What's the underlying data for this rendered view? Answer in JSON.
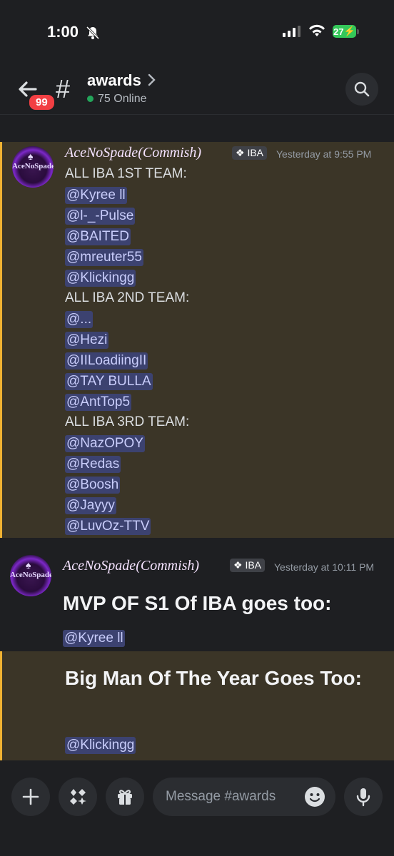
{
  "status_bar": {
    "time": "1:00",
    "battery": "27"
  },
  "header": {
    "unread_badge": "99",
    "channel_name": "awards",
    "online": "75 Online"
  },
  "messages": [
    {
      "author": "AceNoSpade(Commish)",
      "tag": "IBA",
      "timestamp": "Yesterday at 9:55 PM",
      "lines": [
        {
          "text": "ALL IBA 1ST TEAM:",
          "mention": false
        },
        {
          "text": "@Kyree ll",
          "mention": true
        },
        {
          "text": "@l-_-Pulse",
          "mention": true
        },
        {
          "text": "@BAITED",
          "mention": true
        },
        {
          "text": "@mreuter55",
          "mention": true
        },
        {
          "text": "@Klickingg",
          "mention": true
        },
        {
          "text": "ALL IBA 2ND TEAM:",
          "mention": false
        },
        {
          "text": "@...",
          "mention": true
        },
        {
          "text": "@Hezi",
          "mention": true
        },
        {
          "text": "@IILoadiingII",
          "mention": true
        },
        {
          "text": "@TAY BULLA",
          "mention": true
        },
        {
          "text": "@AntTop5",
          "mention": true
        },
        {
          "text": "ALL IBA 3RD TEAM:",
          "mention": false
        },
        {
          "text": "@NazOPOY",
          "mention": true
        },
        {
          "text": "@Redas",
          "mention": true
        },
        {
          "text": "@Boosh",
          "mention": true
        },
        {
          "text": "@Jayyy",
          "mention": true
        },
        {
          "text": "@LuvOz-TTV",
          "mention": true
        }
      ]
    },
    {
      "author": "AceNoSpade(Commish)",
      "tag": "IBA",
      "timestamp": "Yesterday at 10:11 PM",
      "heading": "MVP OF S1 Of IBA goes too:",
      "mention": "@Kyree ll"
    },
    {
      "heading": "Big Man Of The Year Goes Too:",
      "mention": "@Klickingg"
    }
  ],
  "composer": {
    "placeholder": "Message #awards"
  },
  "colors": {
    "background": "#1e1f22",
    "highlight": "#3b3527",
    "highlight_bar": "#f0b232",
    "mention_bg": "#3c4270",
    "online_dot": "#23a55a",
    "badge": "#f23f43"
  }
}
